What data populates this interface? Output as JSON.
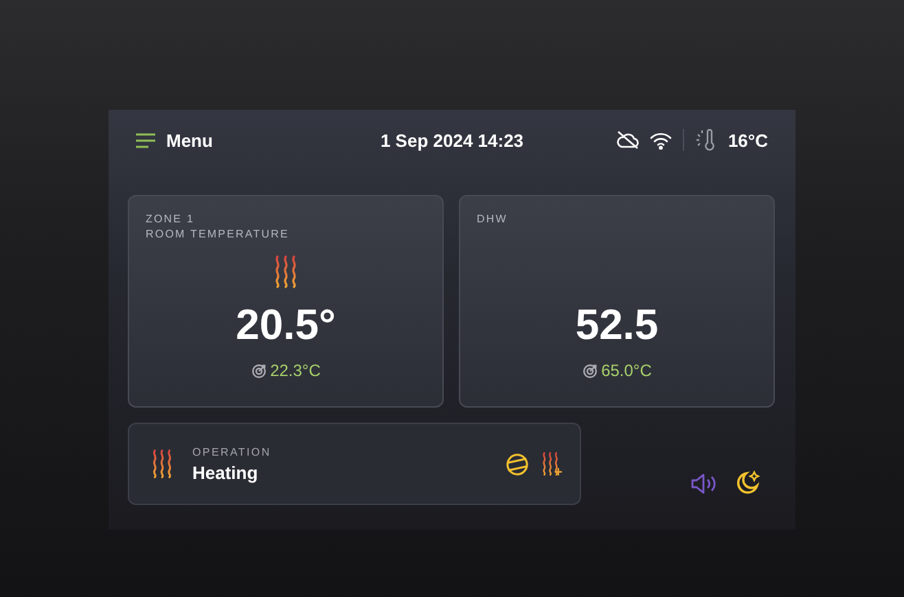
{
  "header": {
    "menu_label": "Menu",
    "datetime": "1 Sep 2024 14:23",
    "outdoor_temp": "16°C"
  },
  "zones": [
    {
      "title": [
        "ZONE 1",
        "ROOM TEMPERATURE"
      ],
      "heating": true,
      "value": "20.5°",
      "target": "22.3°C"
    },
    {
      "title": [
        "DHW"
      ],
      "heating": false,
      "value": "52.5",
      "target": "65.0°C"
    }
  ],
  "operation": {
    "label": "OPERATION",
    "value": "Heating"
  }
}
